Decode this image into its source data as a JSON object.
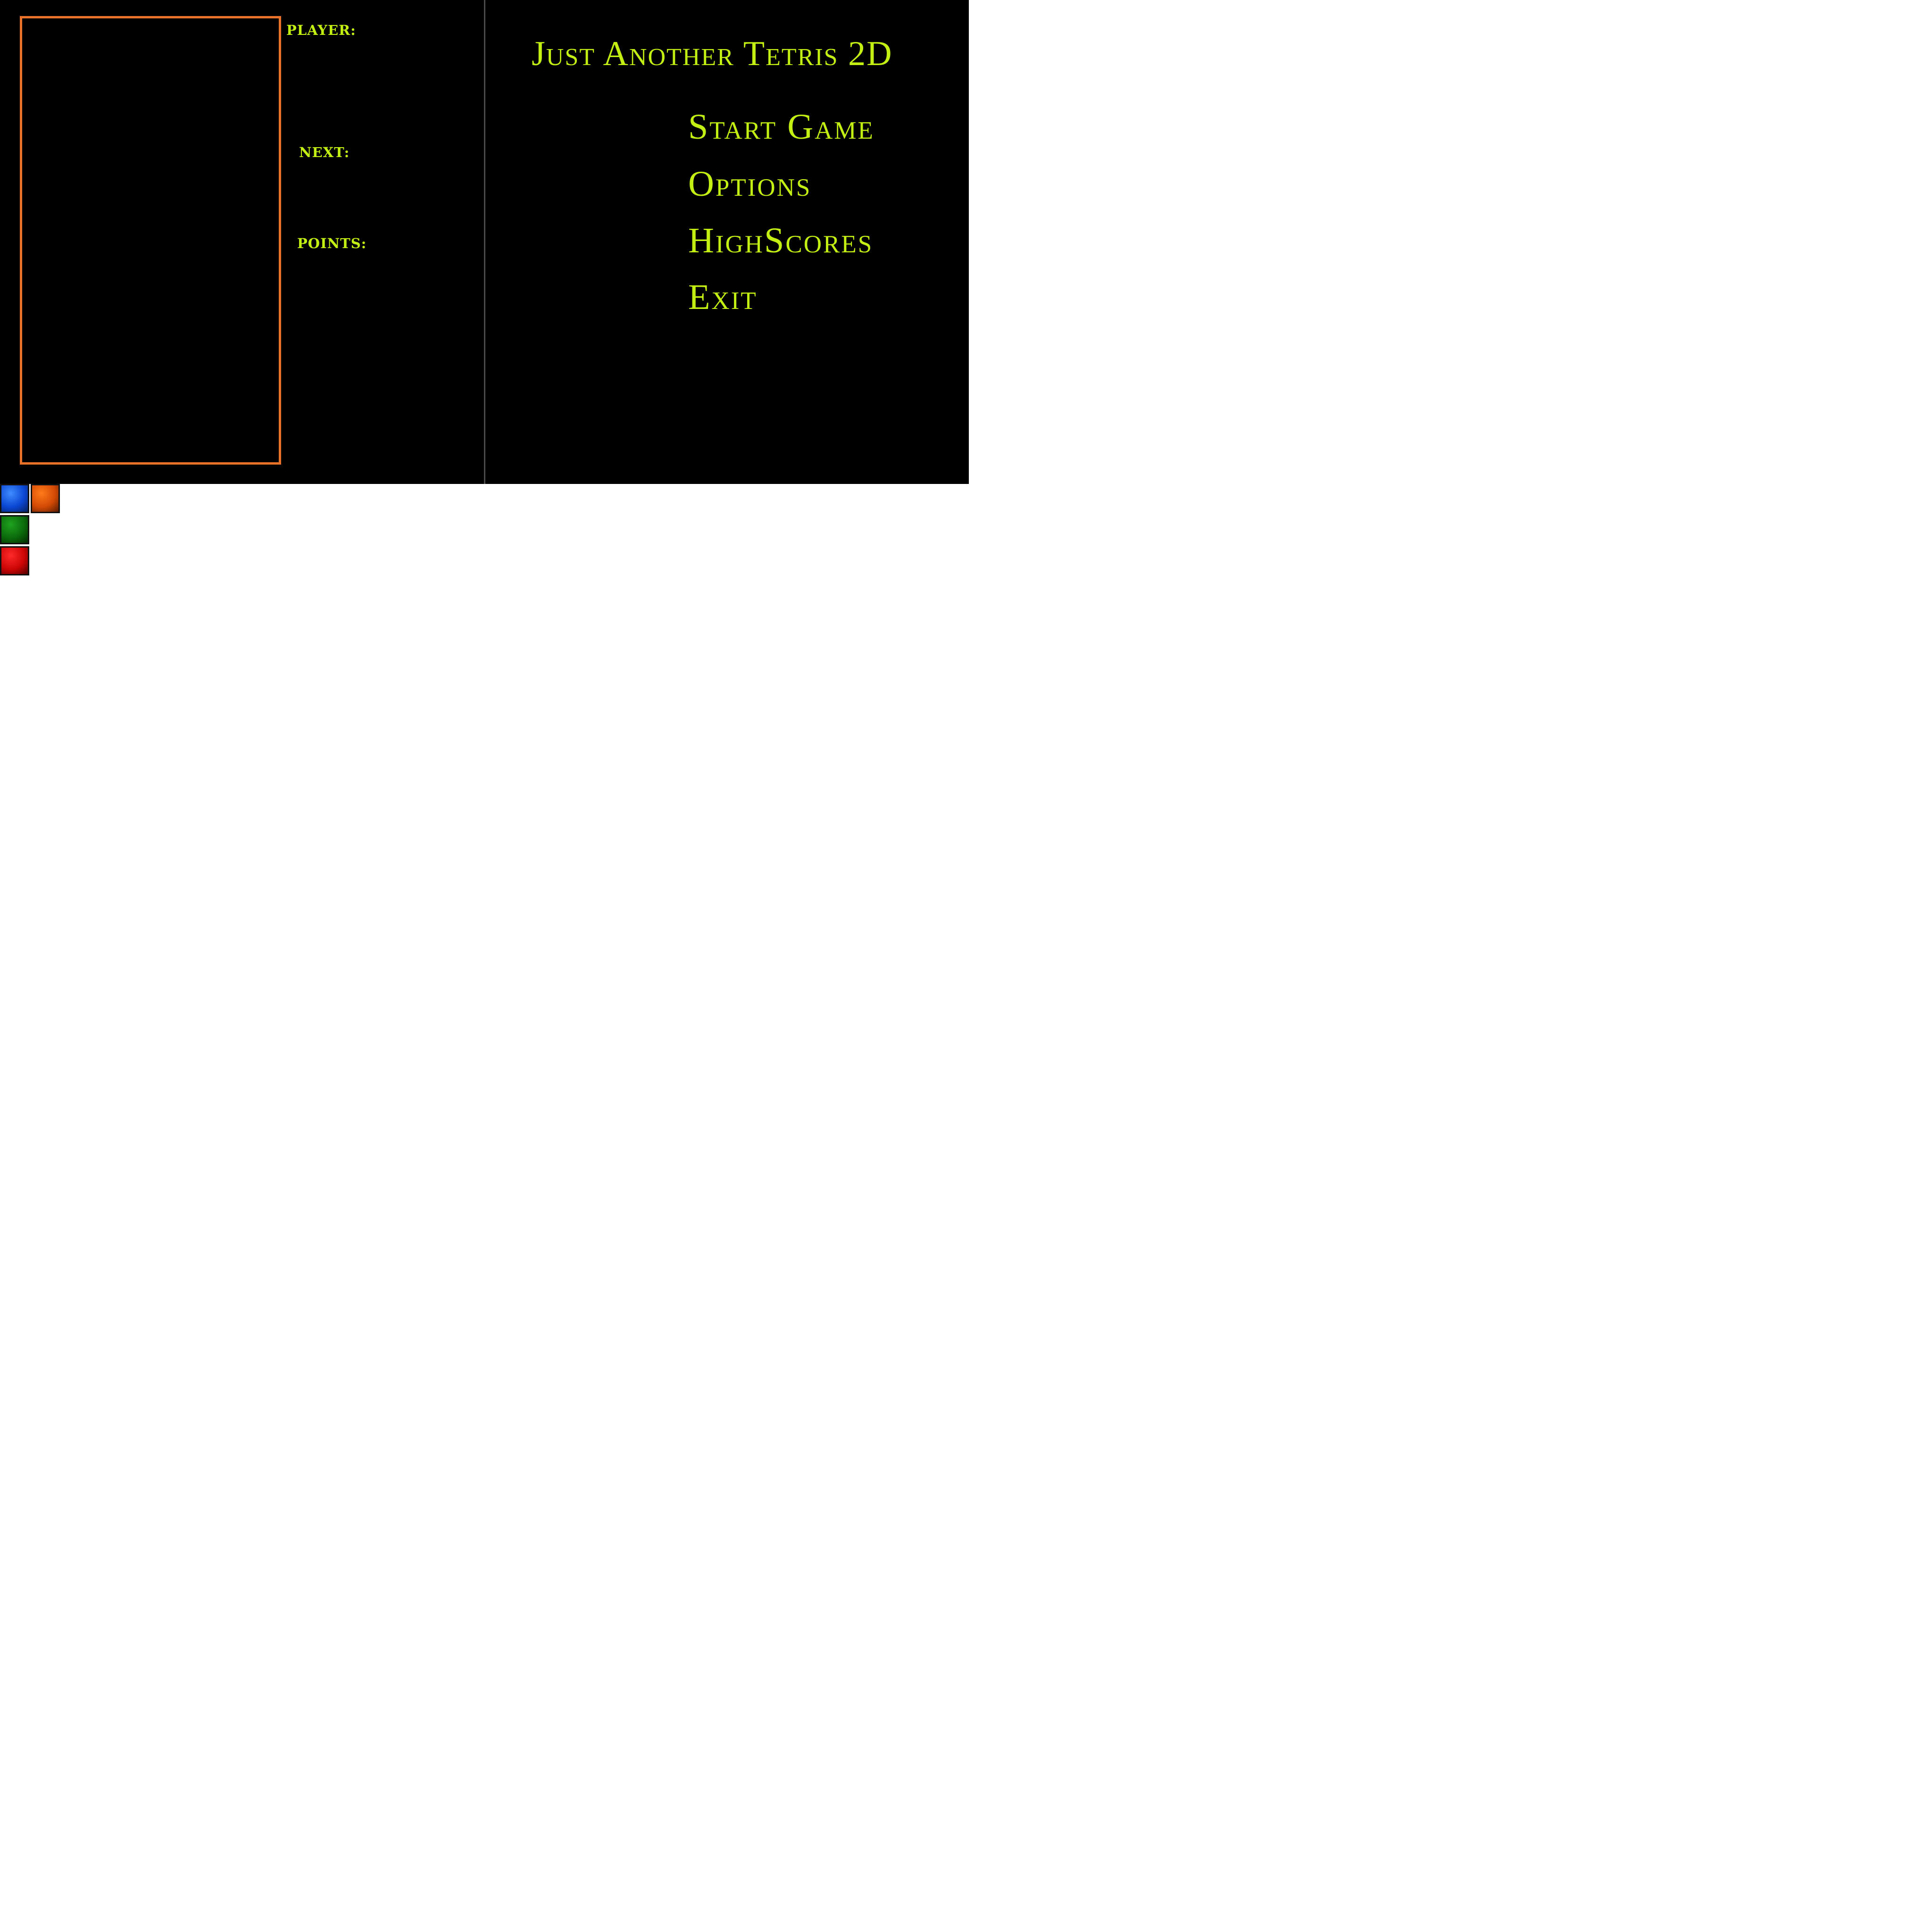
{
  "game": {
    "hud": {
      "player_label": "PLAYER:",
      "next_label": "NEXT:",
      "points_label": "POINTS:"
    },
    "playfield_border_color": "#e8722a"
  },
  "menu": {
    "title": "Just Another Tetris 2D",
    "items": [
      {
        "label": "Start Game"
      },
      {
        "label": "Options"
      },
      {
        "label": "HighScores"
      },
      {
        "label": "Exit"
      }
    ]
  },
  "block_swatches": [
    {
      "color_name": "blue",
      "color": "#0b47d4"
    },
    {
      "color_name": "orange",
      "color": "#d24a05"
    },
    {
      "color_name": "green",
      "color": "#0b6a0b"
    },
    {
      "color_name": "red",
      "color": "#cc0505"
    }
  ],
  "theme": {
    "text_color": "#c3ef13",
    "background": "#000000"
  }
}
